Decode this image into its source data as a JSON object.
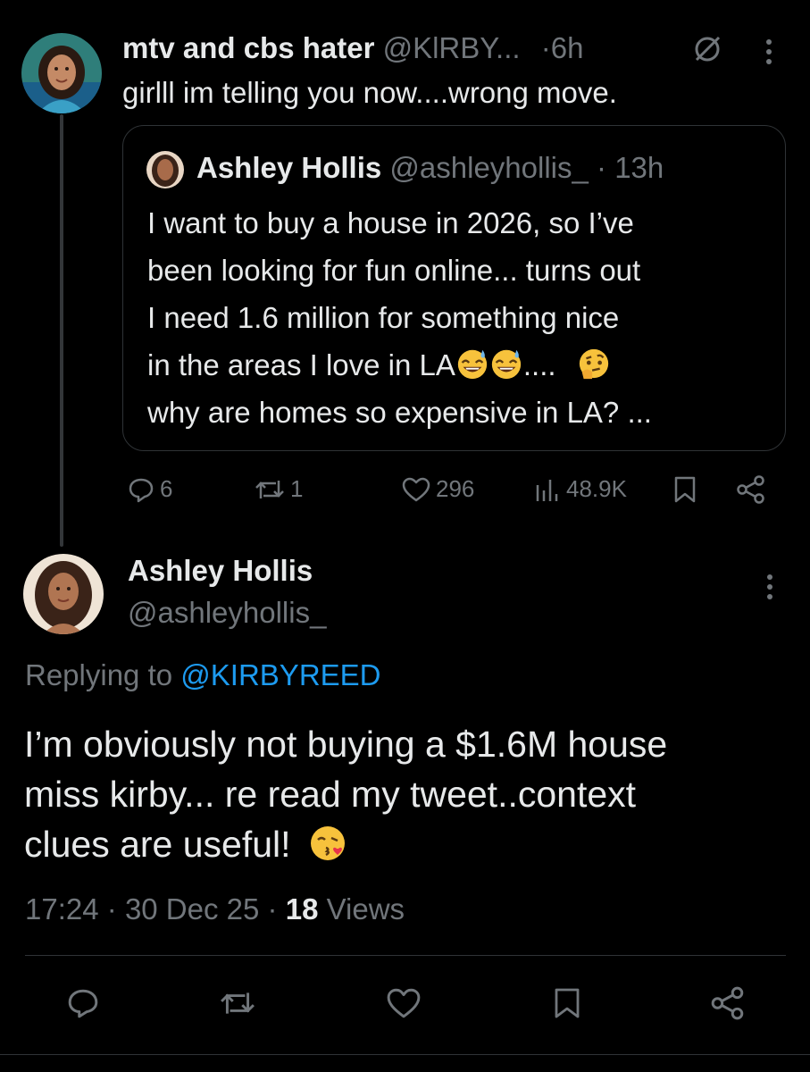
{
  "tweet1": {
    "author_name": "mtv and cbs hater",
    "handle": "@KlRBY...",
    "separator": "·",
    "time": "6h",
    "text": "girlll im telling you now....wrong move."
  },
  "quote": {
    "author_name": "Ashley Hollis",
    "handle": "@ashleyhollis_",
    "time": "· 13h",
    "lines": [
      "I want to buy a house in 2026, so I’ve",
      "been looking for fun online... turns out",
      "I need 1.6 million for something nice",
      "in the areas I love in LA",
      "....",
      "why are homes so expensive in LA? ..."
    ]
  },
  "tweet1_actions": {
    "replies": "6",
    "reposts": "1",
    "likes": "296",
    "views": "48.9K"
  },
  "tweet2": {
    "author_name": "Ashley Hollis",
    "handle": "@ashleyhollis_",
    "replying_prefix": "Replying to",
    "replying_handle": "@KIRBYREED",
    "text_lines": [
      "I’m obviously not buying a $1.6M house",
      "miss kirby... re read my tweet..context",
      "clues are useful!"
    ],
    "time": "17:24",
    "date": "30 Dec 25",
    "views_count": "18",
    "views_label": "Views",
    "separator": "·"
  },
  "icons": {
    "tweet1_extra": "edit-disabled-icon",
    "more": "more-vertical-icon",
    "reply": "reply-icon",
    "repost": "repost-icon",
    "like": "heart-icon",
    "views": "analytics-icon",
    "bookmark": "bookmark-icon",
    "share": "share-icon"
  },
  "colors": {
    "background": "#000000",
    "text_primary": "#e7e9ea",
    "text_secondary": "#71767b",
    "link": "#1d9bf0",
    "border": "#2f3336"
  }
}
